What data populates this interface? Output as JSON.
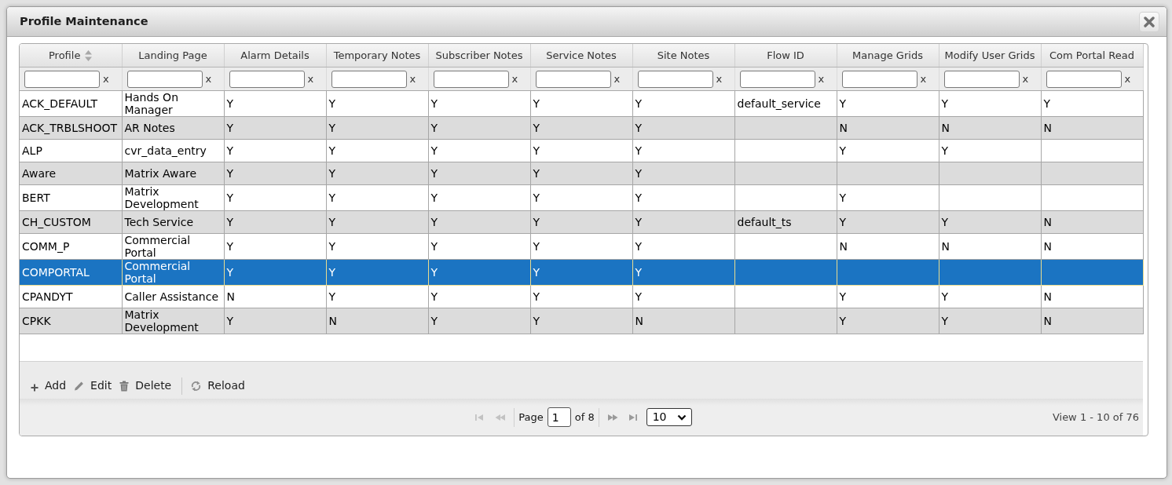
{
  "window": {
    "title": "Profile Maintenance"
  },
  "grid": {
    "columns": [
      {
        "label": "Profile",
        "sorted": true,
        "filter_clear": "x"
      },
      {
        "label": "Landing Page",
        "sorted": false,
        "filter_clear": "x"
      },
      {
        "label": "Alarm Details",
        "sorted": false,
        "filter_clear": "x"
      },
      {
        "label": "Temporary Notes",
        "sorted": false,
        "filter_clear": "x"
      },
      {
        "label": "Subscriber Notes",
        "sorted": false,
        "filter_clear": "x"
      },
      {
        "label": "Service Notes",
        "sorted": false,
        "filter_clear": "x"
      },
      {
        "label": "Site Notes",
        "sorted": false,
        "filter_clear": "x"
      },
      {
        "label": "Flow ID",
        "sorted": false,
        "filter_clear": "x"
      },
      {
        "label": "Manage Grids",
        "sorted": false,
        "filter_clear": "x"
      },
      {
        "label": "Modify User Grids",
        "sorted": false,
        "filter_clear": "x"
      },
      {
        "label": "Com Portal Read",
        "sorted": false,
        "filter_clear": "x"
      }
    ],
    "rows": [
      {
        "selected": false,
        "cells": [
          "ACK_DEFAULT",
          "Hands On Manager",
          "Y",
          "Y",
          "Y",
          "Y",
          "Y",
          "default_service",
          "Y",
          "Y",
          "Y"
        ]
      },
      {
        "selected": false,
        "cells": [
          "ACK_TRBLSHOOT",
          "AR Notes",
          "Y",
          "Y",
          "Y",
          "Y",
          "Y",
          null,
          "N",
          "N",
          "N"
        ]
      },
      {
        "selected": false,
        "cells": [
          "ALP",
          "cvr_data_entry",
          "Y",
          "Y",
          "Y",
          "Y",
          "Y",
          null,
          "Y",
          "Y",
          null
        ]
      },
      {
        "selected": false,
        "cells": [
          "Aware",
          "Matrix Aware",
          "Y",
          "Y",
          "Y",
          "Y",
          "Y",
          null,
          null,
          null,
          null
        ]
      },
      {
        "selected": false,
        "cells": [
          "BERT",
          "Matrix Development",
          "Y",
          "Y",
          "Y",
          "Y",
          "Y",
          null,
          "Y",
          null,
          null
        ]
      },
      {
        "selected": false,
        "cells": [
          "CH_CUSTOM",
          "Tech Service",
          "Y",
          "Y",
          "Y",
          "Y",
          "Y",
          "default_ts",
          "Y",
          "Y",
          "N"
        ]
      },
      {
        "selected": false,
        "cells": [
          "COMM_P",
          "Commercial Portal",
          "Y",
          "Y",
          "Y",
          "Y",
          "Y",
          null,
          "N",
          "N",
          "N"
        ]
      },
      {
        "selected": true,
        "cells": [
          "COMPORTAL",
          "Commercial Portal",
          "Y",
          "Y",
          "Y",
          "Y",
          "Y",
          null,
          null,
          null,
          null
        ]
      },
      {
        "selected": false,
        "cells": [
          "CPANDYT",
          "Caller Assistance",
          "N",
          "Y",
          "Y",
          "Y",
          "Y",
          null,
          "Y",
          "Y",
          "N"
        ]
      },
      {
        "selected": false,
        "cells": [
          "CPKK",
          "Matrix Development",
          "Y",
          "N",
          "Y",
          "Y",
          "N",
          null,
          "Y",
          "Y",
          "N"
        ]
      }
    ]
  },
  "toolbar": {
    "groups": [
      [
        {
          "kind": "add",
          "label": "Add"
        },
        {
          "kind": "edit",
          "label": "Edit"
        },
        {
          "kind": "delete",
          "label": "Delete"
        }
      ],
      [
        {
          "kind": "reload",
          "label": "Reload"
        }
      ]
    ]
  },
  "pager": {
    "nav_before": [
      {
        "kind": "first",
        "disabled": true
      },
      {
        "kind": "prev",
        "disabled": true
      }
    ],
    "page_label": "Page",
    "page": "1",
    "page_count": "of 8",
    "nav_after": [
      {
        "kind": "next",
        "disabled": false
      },
      {
        "kind": "last",
        "disabled": false
      }
    ],
    "rows_per_page": "10",
    "summary": "View 1 - 10 of 76"
  }
}
